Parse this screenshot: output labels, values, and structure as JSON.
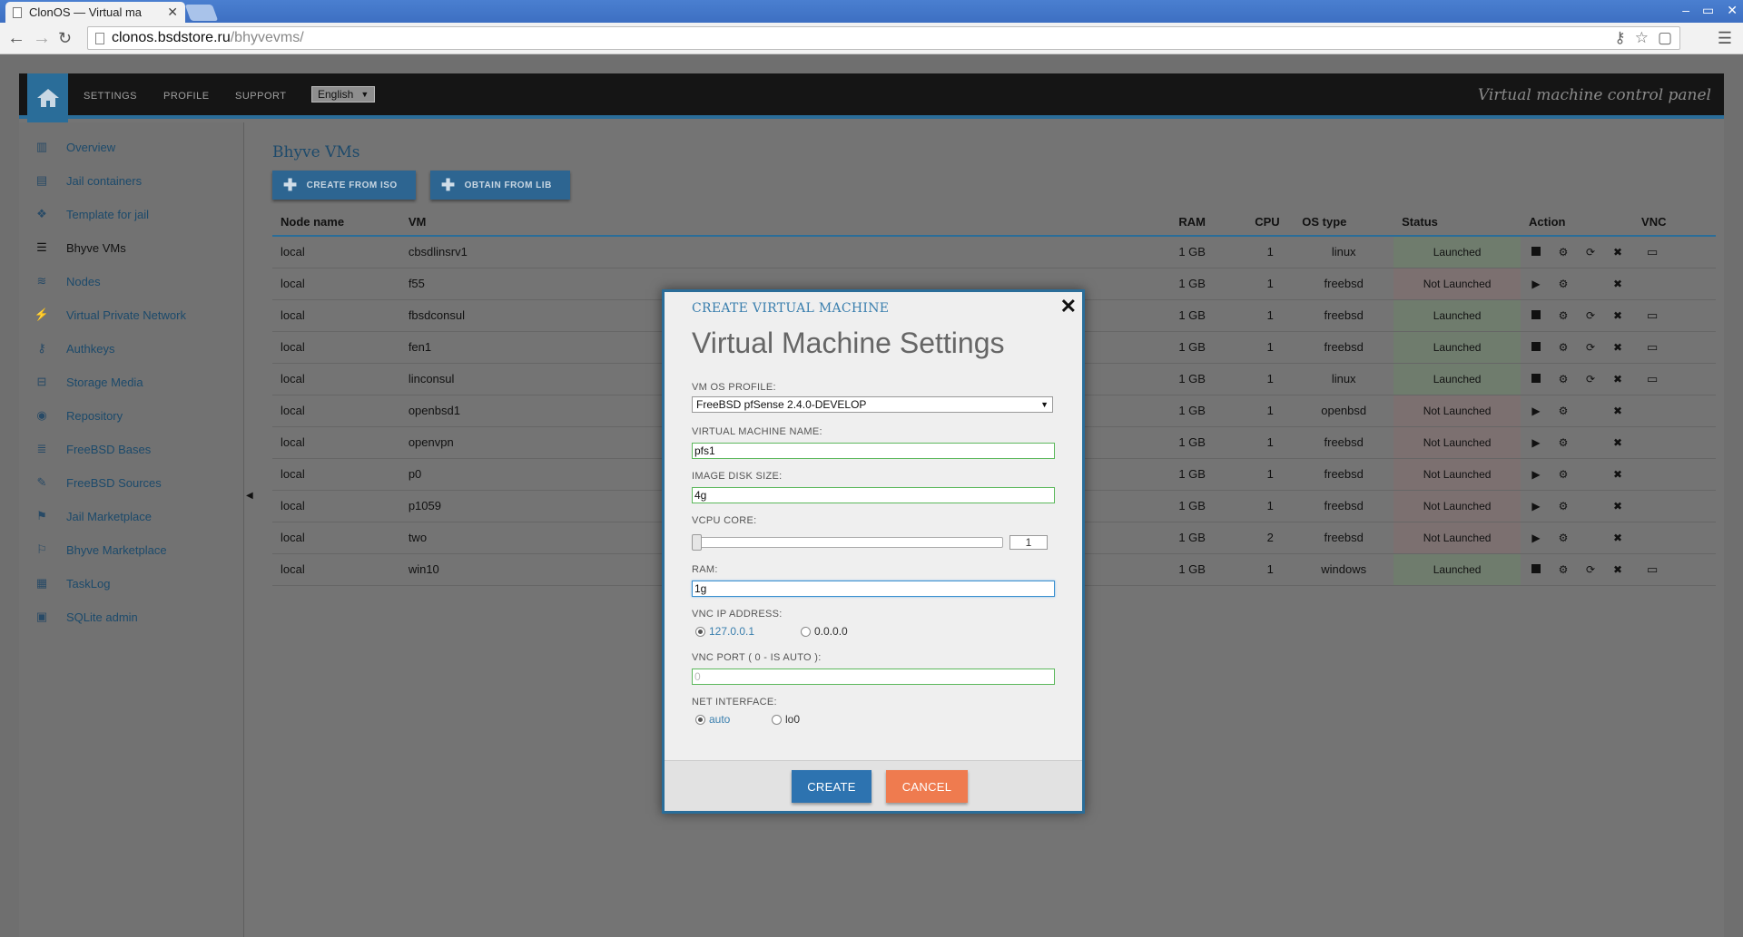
{
  "browser": {
    "tab_title": "ClonOS — Virtual ma",
    "tab_close": "✕",
    "url_host": "clonos.bsdstore.ru",
    "url_path": "/bhyvevms/"
  },
  "header": {
    "nav": [
      "SETTINGS",
      "PROFILE",
      "SUPPORT"
    ],
    "language": "English",
    "brand": "Virtual machine control panel"
  },
  "sidebar": {
    "items": [
      {
        "label": "Overview",
        "icon": "bar-chart-icon"
      },
      {
        "label": "Jail containers",
        "icon": "server-icon"
      },
      {
        "label": "Template for jail",
        "icon": "cubes-icon"
      },
      {
        "label": "Bhyve VMs",
        "icon": "list-icon"
      },
      {
        "label": "Nodes",
        "icon": "layers-icon"
      },
      {
        "label": "Virtual Private Network",
        "icon": "plug-icon"
      },
      {
        "label": "Authkeys",
        "icon": "key-icon"
      },
      {
        "label": "Storage Media",
        "icon": "inbox-icon"
      },
      {
        "label": "Repository",
        "icon": "globe-icon"
      },
      {
        "label": "FreeBSD Bases",
        "icon": "database-icon"
      },
      {
        "label": "FreeBSD Sources",
        "icon": "edit-icon"
      },
      {
        "label": "Jail Marketplace",
        "icon": "flag-icon"
      },
      {
        "label": "Bhyve Marketplace",
        "icon": "flag-outline-icon"
      },
      {
        "label": "TaskLog",
        "icon": "tasklist-icon"
      },
      {
        "label": "SQLite admin",
        "icon": "disk-icon"
      }
    ]
  },
  "main": {
    "heading": "Bhyve VMs",
    "buttons": {
      "create_iso": "CREATE FROM ISO",
      "obtain_lib": "OBTAIN FROM LIB"
    },
    "columns": [
      "Node name",
      "VM",
      "RAM",
      "CPU",
      "OS type",
      "Status",
      "Action",
      "VNC"
    ],
    "rows": [
      {
        "node": "local",
        "vm": "cbsdlinsrv1",
        "ram": "1 GB",
        "cpu": "1",
        "os": "linux",
        "status": "Launched"
      },
      {
        "node": "local",
        "vm": "f55",
        "ram": "1 GB",
        "cpu": "1",
        "os": "freebsd",
        "status": "Not Launched"
      },
      {
        "node": "local",
        "vm": "fbsdconsul",
        "ram": "1 GB",
        "cpu": "1",
        "os": "freebsd",
        "status": "Launched"
      },
      {
        "node": "local",
        "vm": "fen1",
        "ram": "1 GB",
        "cpu": "1",
        "os": "freebsd",
        "status": "Launched"
      },
      {
        "node": "local",
        "vm": "linconsul",
        "ram": "1 GB",
        "cpu": "1",
        "os": "linux",
        "status": "Launched"
      },
      {
        "node": "local",
        "vm": "openbsd1",
        "ram": "1 GB",
        "cpu": "1",
        "os": "openbsd",
        "status": "Not Launched"
      },
      {
        "node": "local",
        "vm": "openvpn",
        "ram": "1 GB",
        "cpu": "1",
        "os": "freebsd",
        "status": "Not Launched"
      },
      {
        "node": "local",
        "vm": "p0",
        "ram": "1 GB",
        "cpu": "1",
        "os": "freebsd",
        "status": "Not Launched"
      },
      {
        "node": "local",
        "vm": "p1059",
        "ram": "1 GB",
        "cpu": "1",
        "os": "freebsd",
        "status": "Not Launched"
      },
      {
        "node": "local",
        "vm": "two",
        "ram": "1 GB",
        "cpu": "2",
        "os": "freebsd",
        "status": "Not Launched"
      },
      {
        "node": "local",
        "vm": "win10",
        "ram": "1 GB",
        "cpu": "1",
        "os": "windows",
        "status": "Launched"
      }
    ]
  },
  "modal": {
    "subtitle": "CREATE VIRTUAL MACHINE",
    "title": "Virtual Machine Settings",
    "close": "✕",
    "os_profile_label": "VM OS PROFILE:",
    "os_profile_value": "FreeBSD pfSense 2.4.0-DEVELOP",
    "vm_name_label": "VIRTUAL MACHINE NAME:",
    "vm_name_value": "pfs1",
    "disk_label": "IMAGE DISK SIZE:",
    "disk_value": "4g",
    "vcpu_label": "VCPU CORE:",
    "vcpu_value": "1",
    "ram_label": "RAM:",
    "ram_value": "1g",
    "vnc_ip_label": "VNC IP ADDRESS:",
    "vnc_ip_options": [
      "127.0.0.1",
      "0.0.0.0"
    ],
    "vnc_port_label": "VNC PORT ( 0 - IS AUTO ):",
    "vnc_port_value": "0",
    "net_label": "NET INTERFACE:",
    "net_options": [
      "auto",
      "lo0"
    ],
    "create": "CREATE",
    "cancel": "CANCEL"
  },
  "colors": {
    "accent": "#2a6d99",
    "create_btn": "#2d73b0",
    "cancel_btn": "#ef7b4f"
  }
}
